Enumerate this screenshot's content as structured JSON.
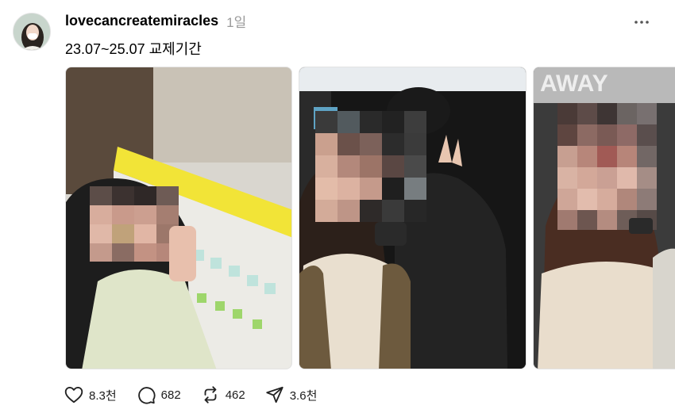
{
  "post": {
    "username": "lovecancreatemiracles",
    "time": "1일",
    "caption": "23.07~25.07 교제기간"
  },
  "actions": {
    "likes": "8.3천",
    "comments": "682",
    "reposts": "462",
    "shares": "3.6천"
  },
  "icons": {
    "like": "heart-icon",
    "comment": "comment-bubble-icon",
    "repost": "repost-icon",
    "share": "send-icon",
    "more": "more-horizontal-icon"
  },
  "colors": {
    "text": "#000000",
    "muted": "#999999",
    "count": "#1c1c1c"
  },
  "photos": [
    "photo-1",
    "photo-2",
    "photo-3"
  ]
}
